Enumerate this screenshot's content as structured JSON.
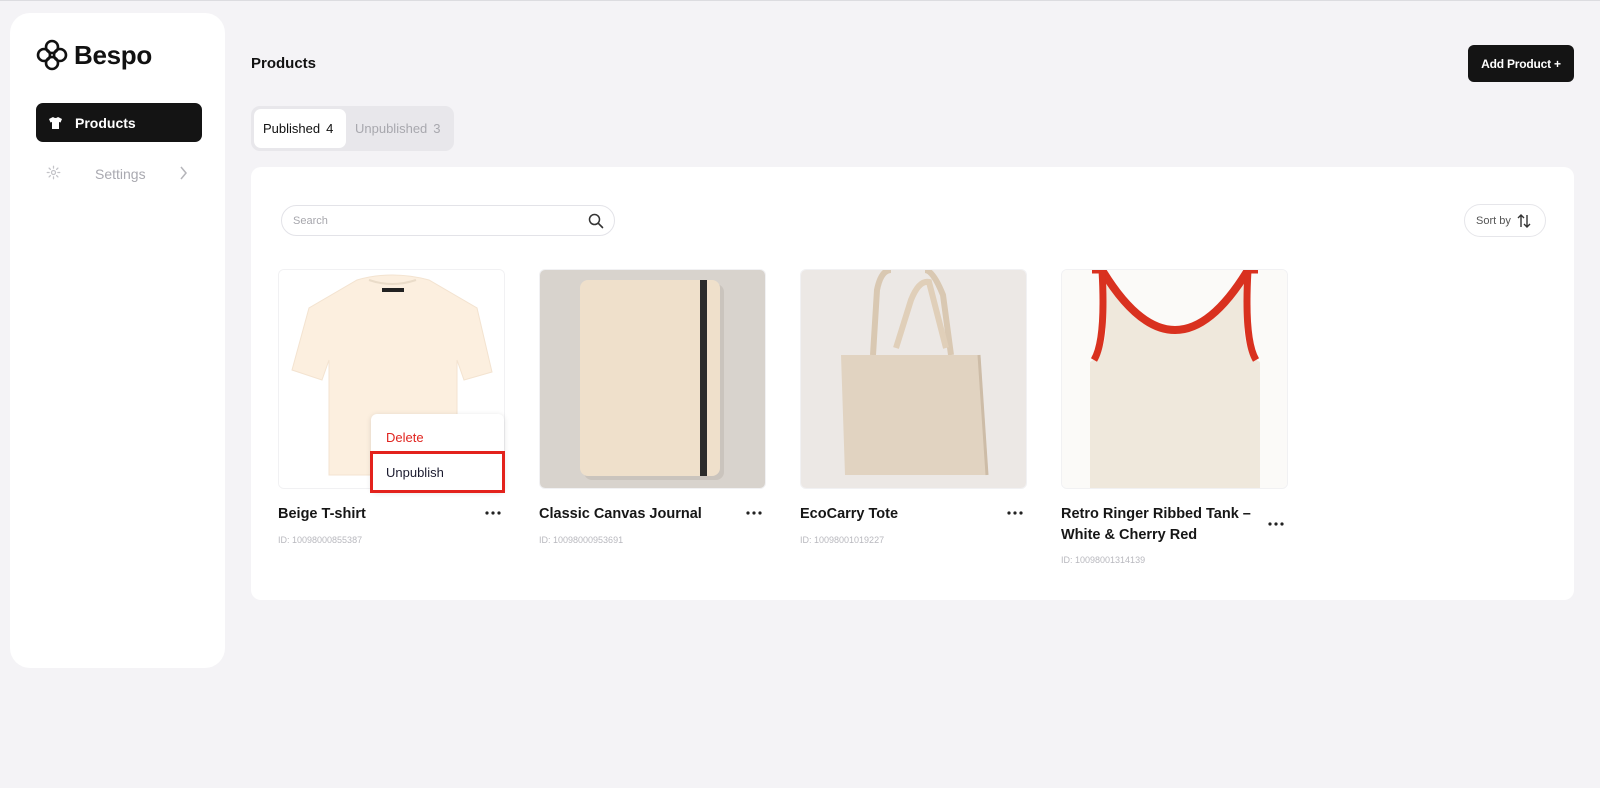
{
  "app": {
    "name": "Bespo"
  },
  "sidebar": {
    "items": [
      {
        "label": "Products",
        "icon": "tshirt-icon",
        "active": true
      },
      {
        "label": "Settings",
        "icon": "gear-icon",
        "active": false
      }
    ]
  },
  "header": {
    "title": "Products",
    "add_button": "Add Product +"
  },
  "tabs": [
    {
      "label": "Published",
      "count": "4",
      "active": true
    },
    {
      "label": "Unpublished",
      "count": "3",
      "active": false
    }
  ],
  "toolbar": {
    "search_placeholder": "Search",
    "sort_label": "Sort by"
  },
  "products": [
    {
      "name": "Beige T-shirt",
      "id": "ID: 10098000855387"
    },
    {
      "name": "Classic Canvas Journal",
      "id": "ID: 10098000953691"
    },
    {
      "name": "EcoCarry Tote",
      "id": "ID: 10098001019227"
    },
    {
      "name": "Retro Ringer Ribbed Tank – White & Cherry Red",
      "id": "ID: 10098001314139"
    }
  ],
  "context_menu": {
    "delete_label": "Delete",
    "unpublish_label": "Unpublish"
  },
  "colors": {
    "primary": "#141414",
    "danger": "#e0241f",
    "highlight": "#e3221c",
    "background": "#f4f3f6"
  }
}
